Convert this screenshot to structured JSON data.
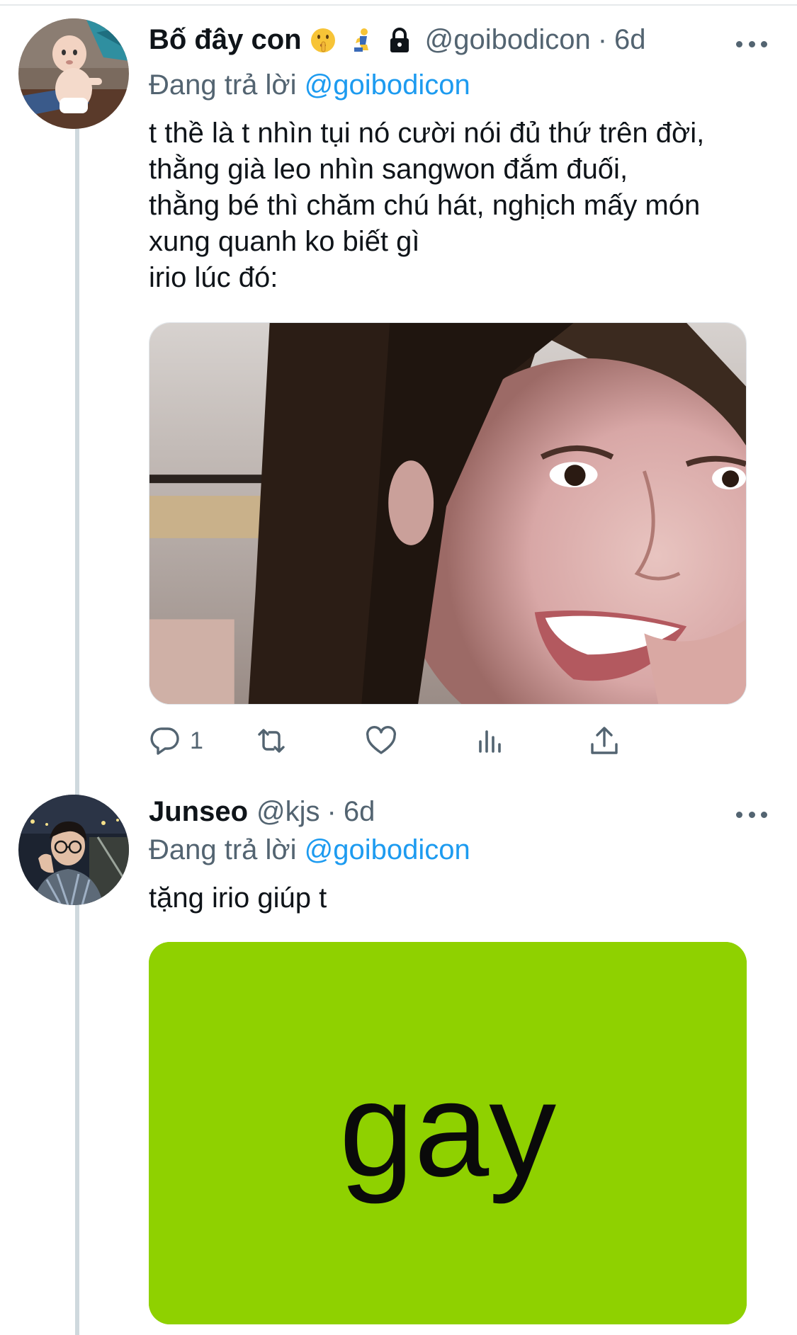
{
  "tweets": [
    {
      "display_name": "Bố đây con",
      "emojis": [
        "shushing-face-emoji",
        "person-kneeling-emoji",
        "lock-icon"
      ],
      "handle": "@goibodicon",
      "separator": "·",
      "time": "6d",
      "reply_prefix": "Đang trả lời",
      "reply_to": "@goibodicon",
      "text_lines": [
        "t thề là t nhìn tụi nó cười nói đủ thứ trên đời,",
        "thằng già leo nhìn sangwon đắm đuối,",
        "thằng bé thì chăm chú hát, nghịch mấy món",
        "xung quanh ko biết gì",
        "irio lúc đó:"
      ],
      "media": "photo of a smiling girl biting her finger",
      "actions": {
        "reply_count": "1",
        "retweet_count": "",
        "like_count": "",
        "views_count": ""
      }
    },
    {
      "display_name": "Junseo",
      "handle": "@kjs",
      "separator": "·",
      "time": "6d",
      "reply_prefix": "Đang trả lời",
      "reply_to": "@goibodicon",
      "text_lines": [
        "tặng irio giúp t"
      ],
      "media_text": "gay"
    }
  ],
  "colors": {
    "link": "#1d9bf0",
    "secondary_text": "#536471",
    "thread_line": "#cfd9de",
    "media_green": "#8fd100"
  }
}
